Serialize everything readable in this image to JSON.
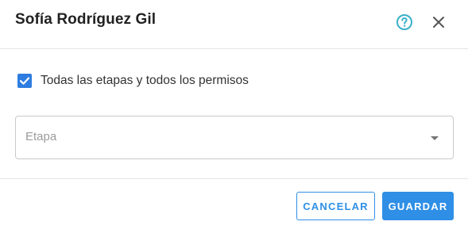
{
  "dialog": {
    "title": "Sofía Rodríguez Gil",
    "help_icon": "help-circle-icon",
    "close_icon": "close-icon"
  },
  "options": {
    "all_stages_checked": true,
    "all_stages_label": "Todas las etapas y todos los permisos"
  },
  "stage_select": {
    "placeholder": "Etapa",
    "selected_value": ""
  },
  "actions": {
    "cancel_label": "CANCELAR",
    "save_label": "GUARDAR"
  },
  "colors": {
    "accent": "#2f8fe6",
    "checkbox": "#2f7de1",
    "help_icon": "#3ab0c9",
    "title": "#222222"
  }
}
